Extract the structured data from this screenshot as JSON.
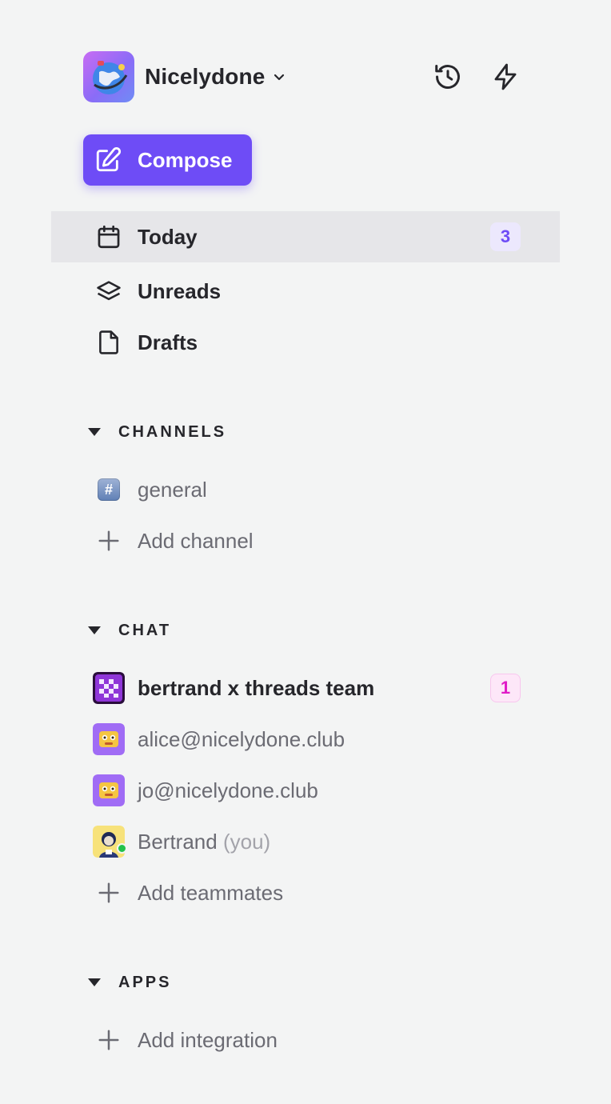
{
  "workspace": {
    "name": "Nicelydone",
    "logo_icon": "globe-logo",
    "chevron_icon": "chevron-down-icon"
  },
  "header_actions": [
    {
      "icon": "history-icon"
    },
    {
      "icon": "lightning-icon"
    }
  ],
  "compose": {
    "label": "Compose",
    "icon": "edit-icon"
  },
  "nav": [
    {
      "label": "Today",
      "icon": "calendar-icon",
      "badge": "3",
      "active": true
    },
    {
      "label": "Unreads",
      "icon": "layers-icon"
    },
    {
      "label": "Drafts",
      "icon": "file-icon"
    }
  ],
  "channels": {
    "title": "CHANNELS",
    "items": [
      {
        "label": "general",
        "icon": "hash-icon"
      }
    ],
    "add_label": "Add channel"
  },
  "chat": {
    "title": "CHAT",
    "items": [
      {
        "label": "bertrand x threads team",
        "badge": "1",
        "unread": true
      },
      {
        "label": "alice@nicelydone.club"
      },
      {
        "label": "jo@nicelydone.club"
      },
      {
        "label": "Bertrand",
        "suffix": "(you)",
        "online": true
      }
    ],
    "add_label": "Add teammates"
  },
  "apps": {
    "title": "APPS",
    "add_label": "Add integration"
  },
  "colors": {
    "accent": "#6e4cf6",
    "background": "#f3f4f4",
    "active_row": "#e6e6e9",
    "text": "#26262b",
    "muted_text": "#6b6b73",
    "pink_badge": "#e01cc7",
    "online": "#22c24a"
  }
}
